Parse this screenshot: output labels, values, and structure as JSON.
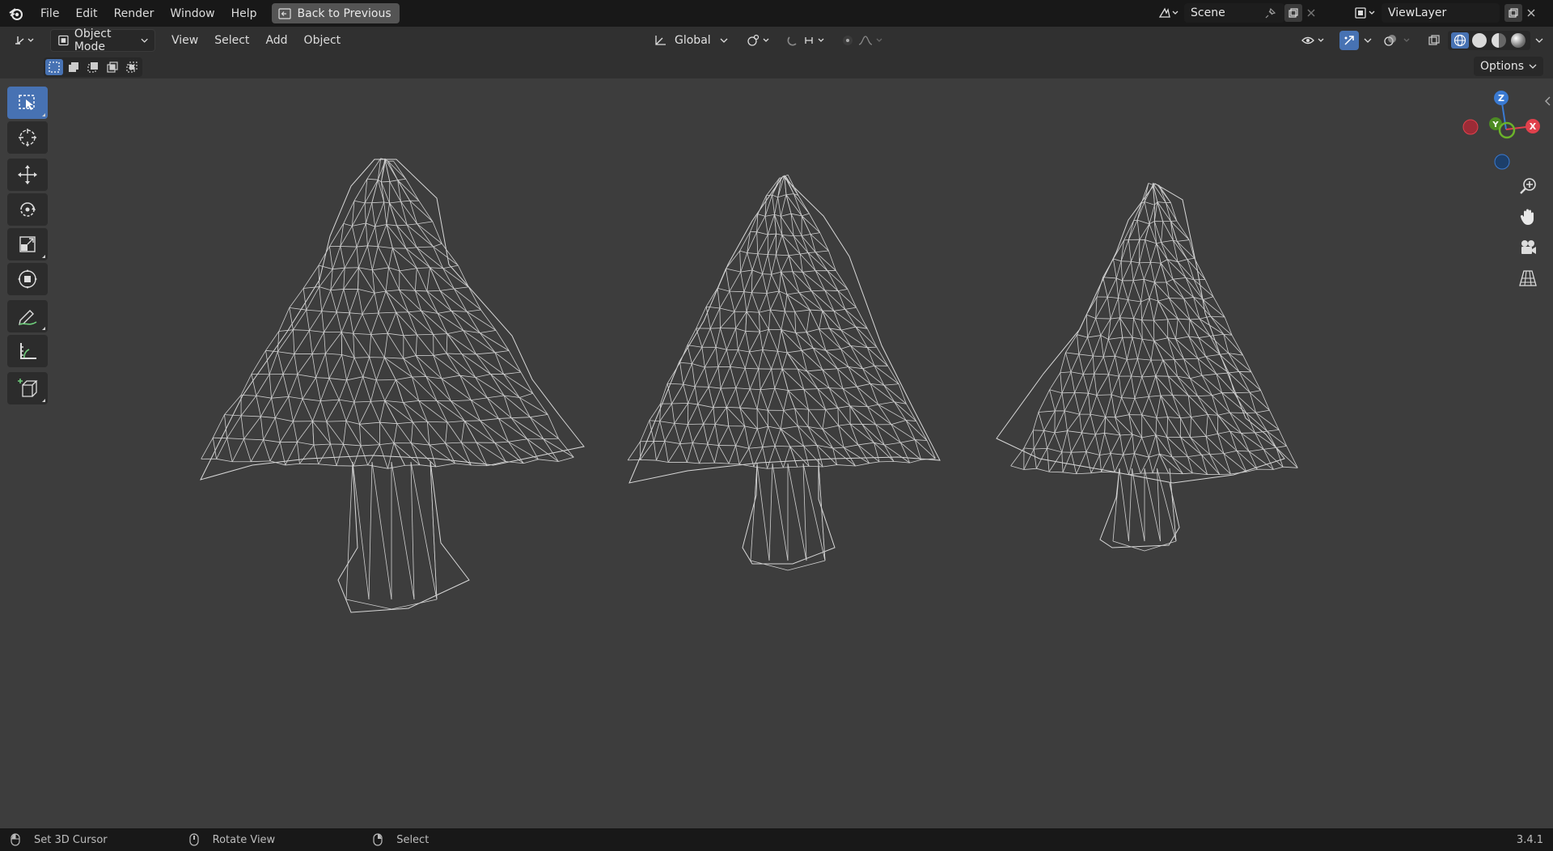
{
  "topbar": {
    "menus": [
      "File",
      "Edit",
      "Render",
      "Window",
      "Help"
    ],
    "back_label": "Back to Previous",
    "scene_name": "Scene",
    "view_layer": "ViewLayer"
  },
  "header": {
    "mode": "Object Mode",
    "menus": [
      "View",
      "Select",
      "Add",
      "Object"
    ],
    "orientation": "Global",
    "options": "Options"
  },
  "gizmo": {
    "z": "Z",
    "y": "Y",
    "x": "X"
  },
  "status": {
    "left": "Set 3D Cursor",
    "middle": "Rotate View",
    "right": "Select",
    "version": "3.4.1"
  },
  "colors": {
    "accent": "#4772b3",
    "x_axis": "#e0414c",
    "y_axis": "#6bb32a",
    "z_axis": "#3a7ad2"
  }
}
